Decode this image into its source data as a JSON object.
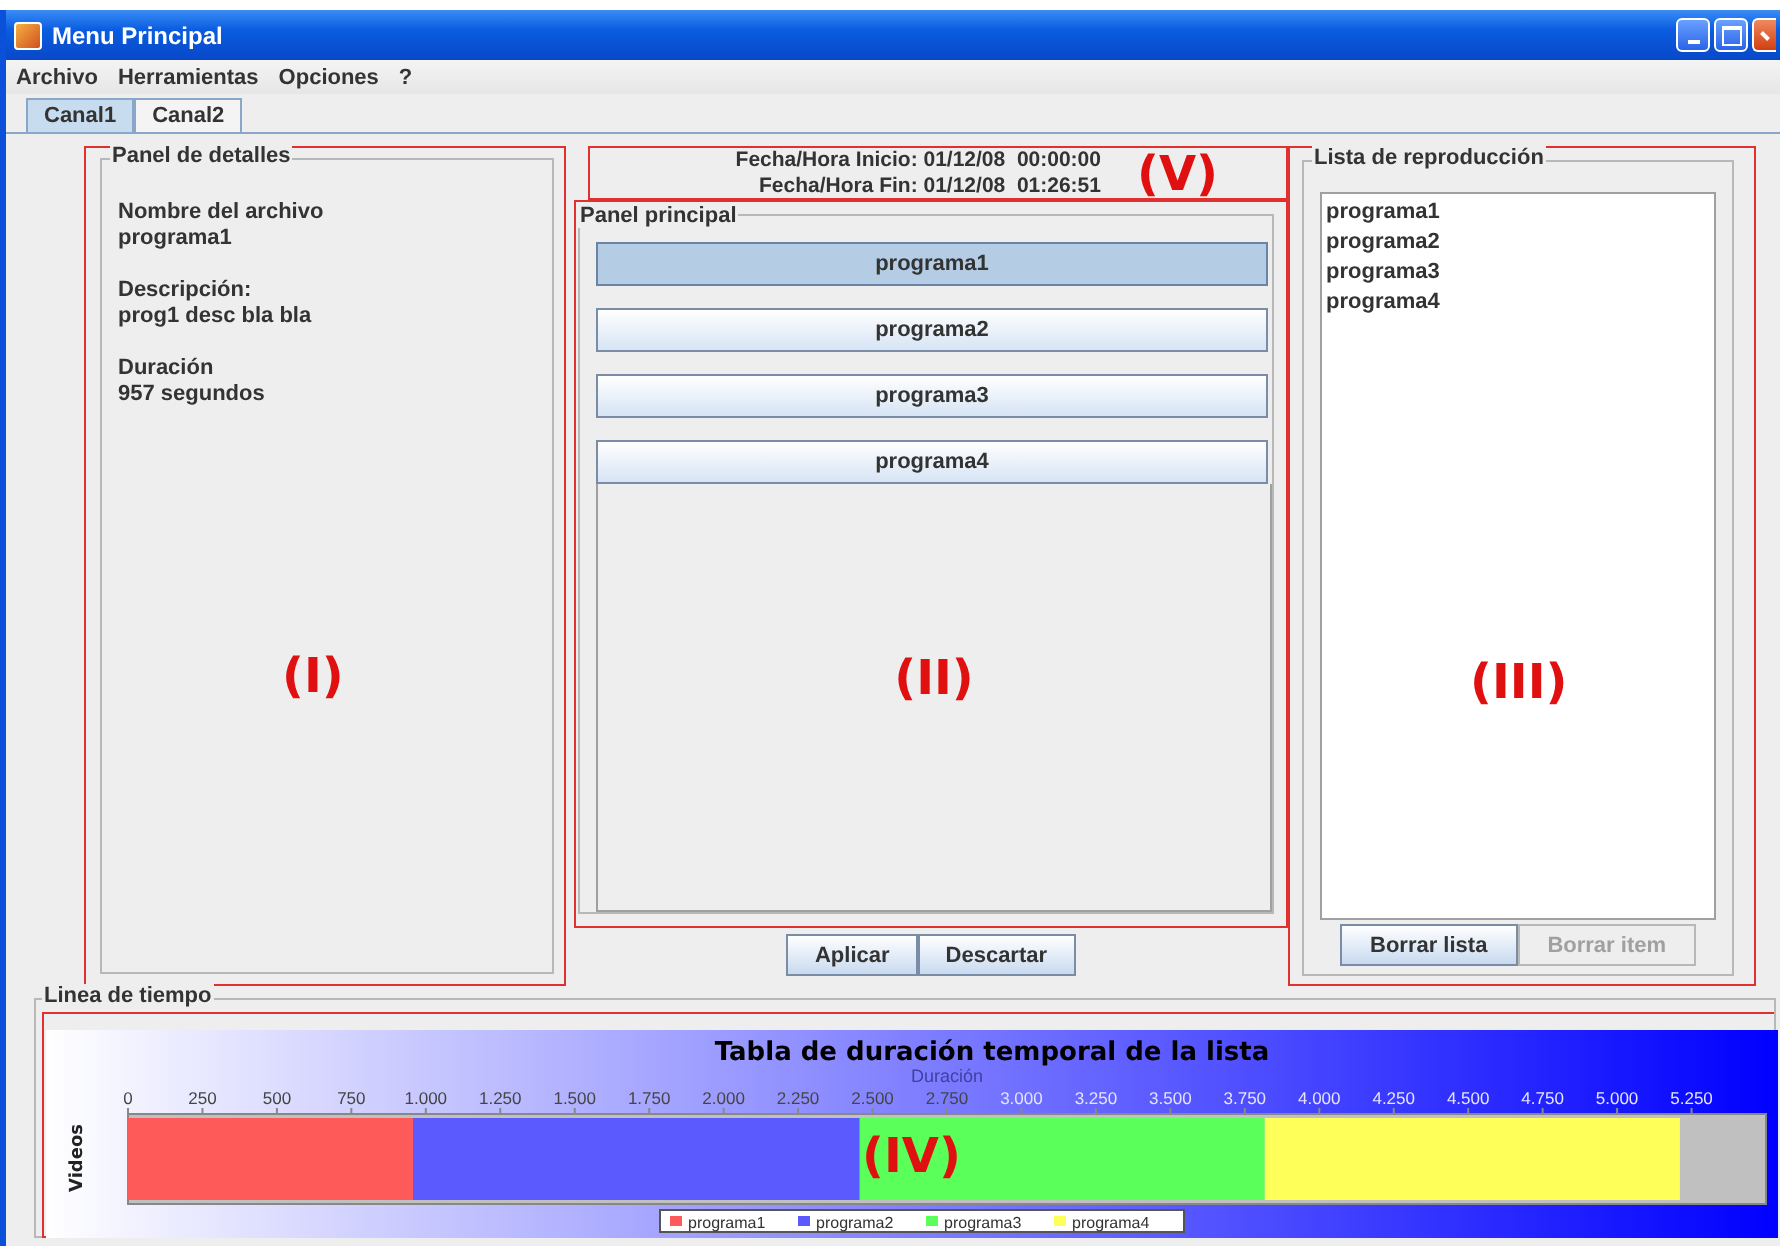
{
  "window": {
    "title": "Menu Principal"
  },
  "menu": [
    "Archivo",
    "Herramientas",
    "Opciones",
    "?"
  ],
  "tabs": [
    {
      "label": "Canal1",
      "selected": true
    },
    {
      "label": "Canal2",
      "selected": false
    }
  ],
  "details_panel": {
    "title": "Panel de detalles",
    "annotation": "(I)",
    "fields": [
      {
        "label": "Nombre del archivo",
        "value": "programa1"
      },
      {
        "label": "Descripción:",
        "value": "prog1 desc bla bla"
      },
      {
        "label": "Duración",
        "value": "957 segundos"
      }
    ]
  },
  "schedule": {
    "start": "Fecha/Hora Inicio: 01/12/08  00:00:00",
    "end": "Fecha/Hora Fin: 01/12/08  01:26:51",
    "annotation": "(V)"
  },
  "main_panel": {
    "title": "Panel principal",
    "annotation": "(II)",
    "programs": [
      {
        "label": "programa1",
        "selected": true
      },
      {
        "label": "programa2",
        "selected": false
      },
      {
        "label": "programa3",
        "selected": false
      },
      {
        "label": "programa4",
        "selected": false
      }
    ]
  },
  "buttons": [
    {
      "label": "Aplicar",
      "disabled": false
    },
    {
      "label": "Descartar",
      "disabled": false
    }
  ],
  "playlist": {
    "title": "Lista de reproducción",
    "annotation": "(III)",
    "items": [
      "programa1",
      "programa2",
      "programa3",
      "programa4"
    ],
    "buttons": [
      {
        "label": "Borrar lista",
        "disabled": false
      },
      {
        "label": "Borrar item",
        "disabled": true
      }
    ]
  },
  "timeline": {
    "title": "Linea de tiempo",
    "annotation": "(IV)",
    "chart_data": {
      "type": "bar",
      "orientation": "horizontal",
      "stacked": true,
      "legend": "bottom",
      "title": "Tabla de duración temporal de la lista",
      "xlabel": "Duración",
      "ylabel": "Videos",
      "xlim": [
        0,
        5500
      ],
      "xticks": [
        0,
        250,
        500,
        750,
        {
          "value": 1000,
          "label": "1.000"
        },
        {
          "value": 1250,
          "label": "1.250"
        },
        {
          "value": 1500,
          "label": "1.500"
        },
        {
          "value": 1750,
          "label": "1.750"
        },
        {
          "value": 2000,
          "label": "2.000"
        },
        {
          "value": 2250,
          "label": "2.250"
        },
        {
          "value": 2500,
          "label": "2.500"
        },
        {
          "value": 2750,
          "label": "2.750"
        },
        {
          "value": 3000,
          "label": "3.000"
        },
        {
          "value": 3250,
          "label": "3.250"
        },
        {
          "value": 3500,
          "label": "3.500"
        },
        {
          "value": 3750,
          "label": "3.750"
        },
        {
          "value": 4000,
          "label": "4.000"
        },
        {
          "value": 4250,
          "label": "4.250"
        },
        {
          "value": 4500,
          "label": "4.500"
        },
        {
          "value": 4750,
          "label": "4.750"
        },
        {
          "value": 5000,
          "label": "5.000"
        },
        {
          "value": 5250,
          "label": "5.250"
        }
      ],
      "series": [
        {
          "name": "programa1",
          "color": "#ff5a5a",
          "values": [
            957
          ]
        },
        {
          "name": "programa2",
          "color": "#5a5aff",
          "values": [
            1500
          ]
        },
        {
          "name": "programa3",
          "color": "#5aff5a",
          "values": [
            1360
          ]
        },
        {
          "name": "programa4",
          "color": "#ffff5a",
          "values": [
            1394
          ]
        }
      ]
    }
  }
}
